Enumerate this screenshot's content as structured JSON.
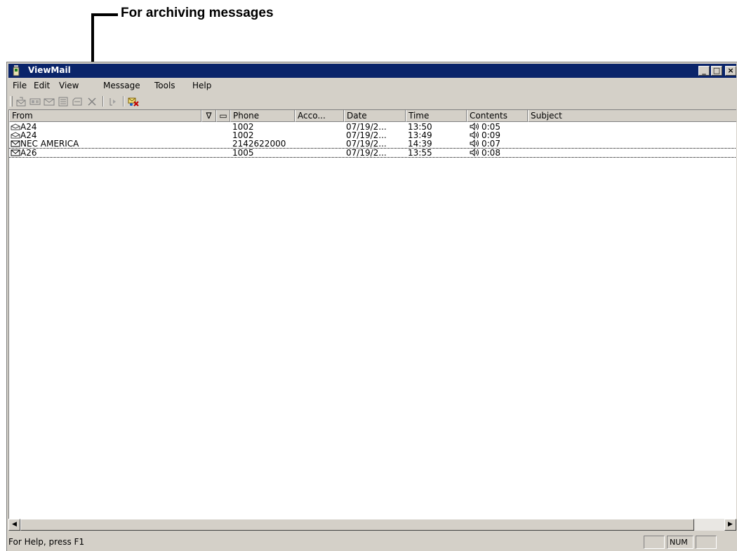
{
  "annotation": {
    "text": "For archiving messages"
  },
  "window": {
    "title": "ViewMail",
    "buttons": {
      "minimize": "_",
      "maximize": "□",
      "close": "×"
    }
  },
  "menu": [
    "File",
    "Edit",
    "View",
    "Message",
    "Tools",
    "Help"
  ],
  "toolbar": {
    "icons": [
      "reply-icon",
      "forward-icon",
      "forward-all-icon",
      "properties-icon",
      "archive-icon",
      "delete-icon",
      "play-icon",
      "sync-icon"
    ]
  },
  "columns": [
    "From",
    "∇",
    "▭",
    "Phone",
    "Acco...",
    "Date",
    "Time",
    "Contents",
    "Subject"
  ],
  "messages": [
    {
      "icon": "opened-envelope-icon",
      "from": "A24",
      "phone": "1002",
      "account": "",
      "date": "07/19/2...",
      "time": "13:50",
      "contents": "0:05",
      "subject": ""
    },
    {
      "icon": "opened-envelope-icon",
      "from": "A24",
      "phone": "1002",
      "account": "",
      "date": "07/19/2...",
      "time": "13:49",
      "contents": "0:09",
      "subject": ""
    },
    {
      "icon": "envelope-icon",
      "from": "NEC AMERICA",
      "phone": "2142622000",
      "account": "",
      "date": "07/19/2...",
      "time": "14:39",
      "contents": "0:07",
      "subject": ""
    },
    {
      "icon": "envelope-icon",
      "from": "A26",
      "phone": "1005",
      "account": "",
      "date": "07/19/2...",
      "time": "13:55",
      "contents": "0:08",
      "subject": ""
    }
  ],
  "status": {
    "help_text": "For Help, press F1",
    "num_indicator": "NUM"
  },
  "colors": {
    "titlebar": "#0a246a",
    "face": "#d4d0c8",
    "list_bg": "#ffffff"
  }
}
